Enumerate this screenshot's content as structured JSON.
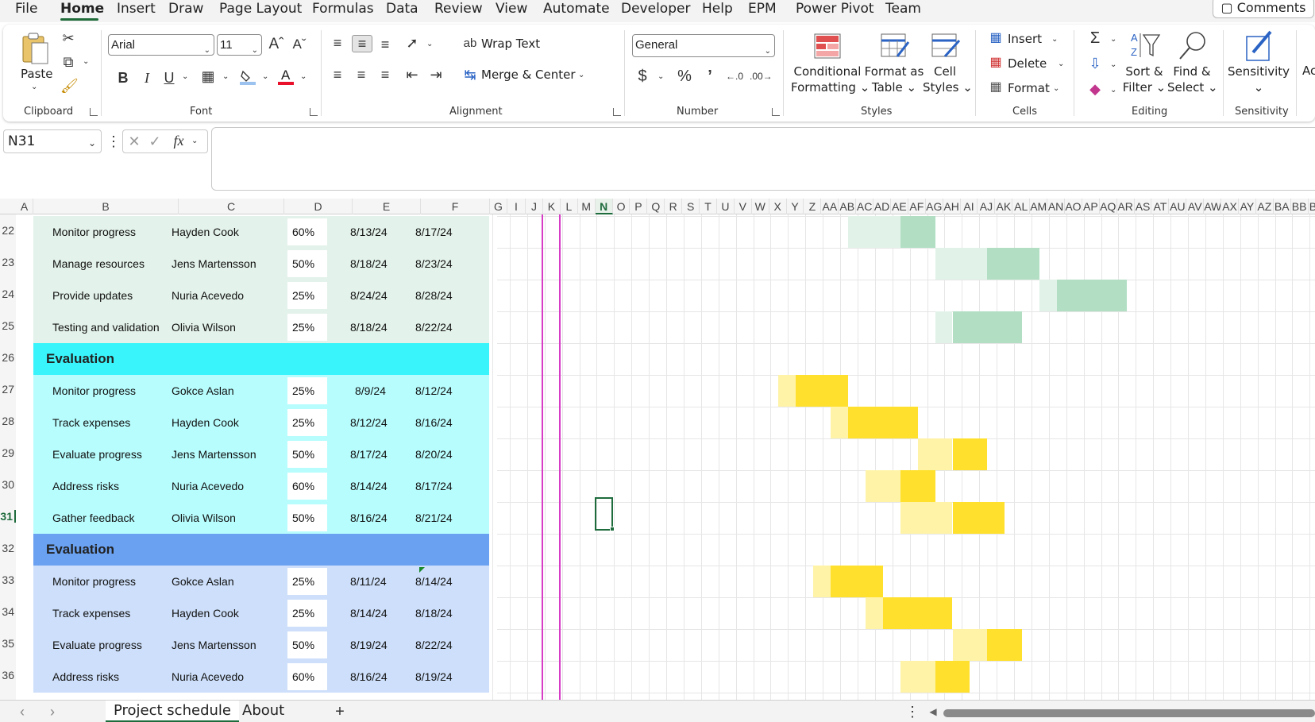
{
  "menubar": {
    "items": [
      "File",
      "Home",
      "Insert",
      "Draw",
      "Page Layout",
      "Formulas",
      "Data",
      "Review",
      "View",
      "Automate",
      "Developer",
      "Help",
      "EPM",
      "Power Pivot",
      "Team"
    ],
    "active": "Home",
    "comments_label": "Comments"
  },
  "ribbon": {
    "groups": {
      "clipboard": "Clipboard",
      "font": "Font",
      "alignment": "Alignment",
      "number": "Number",
      "styles": "Styles",
      "cells": "Cells",
      "editing": "Editing",
      "sensitivity": "Sensitivity"
    },
    "paste_label": "Paste",
    "font_name": "Arial",
    "font_size": "11",
    "wrap_text": "Wrap Text",
    "merge_center": "Merge & Center",
    "number_format": "General",
    "conditional_formatting": [
      "Conditional",
      "Formatting"
    ],
    "format_as_table": [
      "Format as",
      "Table"
    ],
    "cell_styles": [
      "Cell",
      "Styles"
    ],
    "insert": "Insert",
    "delete": "Delete",
    "format": "Format",
    "sort_filter": [
      "Sort &",
      "Filter"
    ],
    "find_select": [
      "Find &",
      "Select"
    ],
    "sensitivity_btn": "Sensitivity",
    "cut_ahead": "Ac"
  },
  "formula_bar": {
    "name_box": "N31",
    "fx": "fx",
    "value": ""
  },
  "columns": [
    "A",
    "B",
    "C",
    "D",
    "E",
    "F",
    "G",
    "I",
    "J",
    "K",
    "L",
    "M",
    "N",
    "O",
    "P",
    "Q",
    "R",
    "S",
    "T",
    "U",
    "V",
    "W",
    "X",
    "Y",
    "Z",
    "AA",
    "AB",
    "AC",
    "AD",
    "AE",
    "AF",
    "AG",
    "AH",
    "AI",
    "AJ",
    "AK",
    "AL",
    "AM",
    "AN",
    "AO",
    "AP",
    "AQ",
    "AR",
    "AS",
    "AT",
    "AU",
    "AV",
    "AW",
    "AX",
    "AY",
    "AZ",
    "BA",
    "BB",
    "BE"
  ],
  "selected_column": "N",
  "selected_row": "31",
  "rows": [
    {
      "num": "22",
      "type": "task",
      "task": "Monitor progress",
      "owner": "Hayden Cook",
      "pct": "60%",
      "start": "8/13/24",
      "end": "8/17/24",
      "section": "green"
    },
    {
      "num": "23",
      "type": "task",
      "task": "Manage resources",
      "owner": "Jens Martensson",
      "pct": "50%",
      "start": "8/18/24",
      "end": "8/23/24",
      "section": "green"
    },
    {
      "num": "24",
      "type": "task",
      "task": "Provide updates",
      "owner": "Nuria Acevedo",
      "pct": "25%",
      "start": "8/24/24",
      "end": "8/28/24",
      "section": "green"
    },
    {
      "num": "25",
      "type": "task",
      "task": "Testing and validation",
      "owner": "Olivia Wilson",
      "pct": "25%",
      "start": "8/18/24",
      "end": "8/22/24",
      "section": "green"
    },
    {
      "num": "26",
      "type": "header",
      "title": "Evaluation",
      "section": "cyan"
    },
    {
      "num": "27",
      "type": "task",
      "task": "Monitor progress",
      "owner": "Gokce Aslan",
      "pct": "25%",
      "start": "8/9/24",
      "end": "8/12/24",
      "section": "cyan"
    },
    {
      "num": "28",
      "type": "task",
      "task": "Track expenses",
      "owner": "Hayden Cook",
      "pct": "25%",
      "start": "8/12/24",
      "end": "8/16/24",
      "section": "cyan"
    },
    {
      "num": "29",
      "type": "task",
      "task": "Evaluate progress",
      "owner": "Jens Martensson",
      "pct": "50%",
      "start": "8/17/24",
      "end": "8/20/24",
      "section": "cyan"
    },
    {
      "num": "30",
      "type": "task",
      "task": "Address risks",
      "owner": "Nuria Acevedo",
      "pct": "60%",
      "start": "8/14/24",
      "end": "8/17/24",
      "section": "cyan"
    },
    {
      "num": "31",
      "type": "task",
      "task": "Gather feedback",
      "owner": "Olivia Wilson",
      "pct": "50%",
      "start": "8/16/24",
      "end": "8/21/24",
      "section": "cyan"
    },
    {
      "num": "32",
      "type": "header",
      "title": "Evaluation",
      "section": "blue"
    },
    {
      "num": "33",
      "type": "task",
      "task": "Monitor progress",
      "owner": "Gokce Aslan",
      "pct": "25%",
      "start": "8/11/24",
      "end": "8/14/24",
      "section": "blue"
    },
    {
      "num": "34",
      "type": "task",
      "task": "Track expenses",
      "owner": "Hayden Cook",
      "pct": "25%",
      "start": "8/14/24",
      "end": "8/18/24",
      "section": "blue"
    },
    {
      "num": "35",
      "type": "task",
      "task": "Evaluate progress",
      "owner": "Jens Martensson",
      "pct": "50%",
      "start": "8/19/24",
      "end": "8/22/24",
      "section": "blue"
    },
    {
      "num": "36",
      "type": "task",
      "task": "Address risks",
      "owner": "Nuria Acevedo",
      "pct": "60%",
      "start": "8/16/24",
      "end": "8/19/24",
      "section": "blue"
    }
  ],
  "colors": {
    "green_band": "#e3f2ea",
    "green_bar_light": "#e1f3e9",
    "green_bar_dark": "#b2dfc4",
    "cyan_header": "#39f5fb",
    "cyan_band": "#b8fdfe",
    "blue_header": "#6aa1f1",
    "blue_band": "#cddffa",
    "yellow_bar_light": "#fff3a8",
    "yellow_bar_dark": "#ffe02c",
    "accent": "#1e6b3c",
    "today_line": "#d63cc6"
  },
  "sheet_tabs": [
    "Project schedule",
    "About"
  ],
  "active_tab": "Project schedule"
}
